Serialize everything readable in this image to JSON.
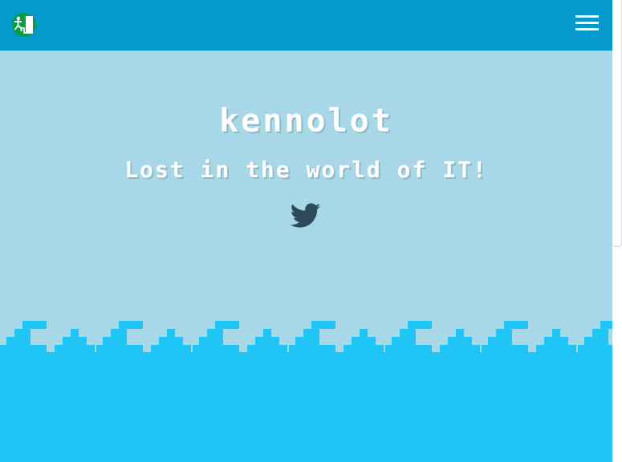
{
  "header": {
    "logo_icon": "exit-runner-logo",
    "menu_icon": "hamburger-menu-icon"
  },
  "hero": {
    "title": "kennolot",
    "subtitle": "Lost in the world of IT!",
    "social_icon": "twitter-icon"
  },
  "colors": {
    "navbar": "#0599cc",
    "sky": "#a8d8e8",
    "water": "#1ec5f5",
    "text": "#ffffff",
    "icon": "#2c4a58"
  }
}
